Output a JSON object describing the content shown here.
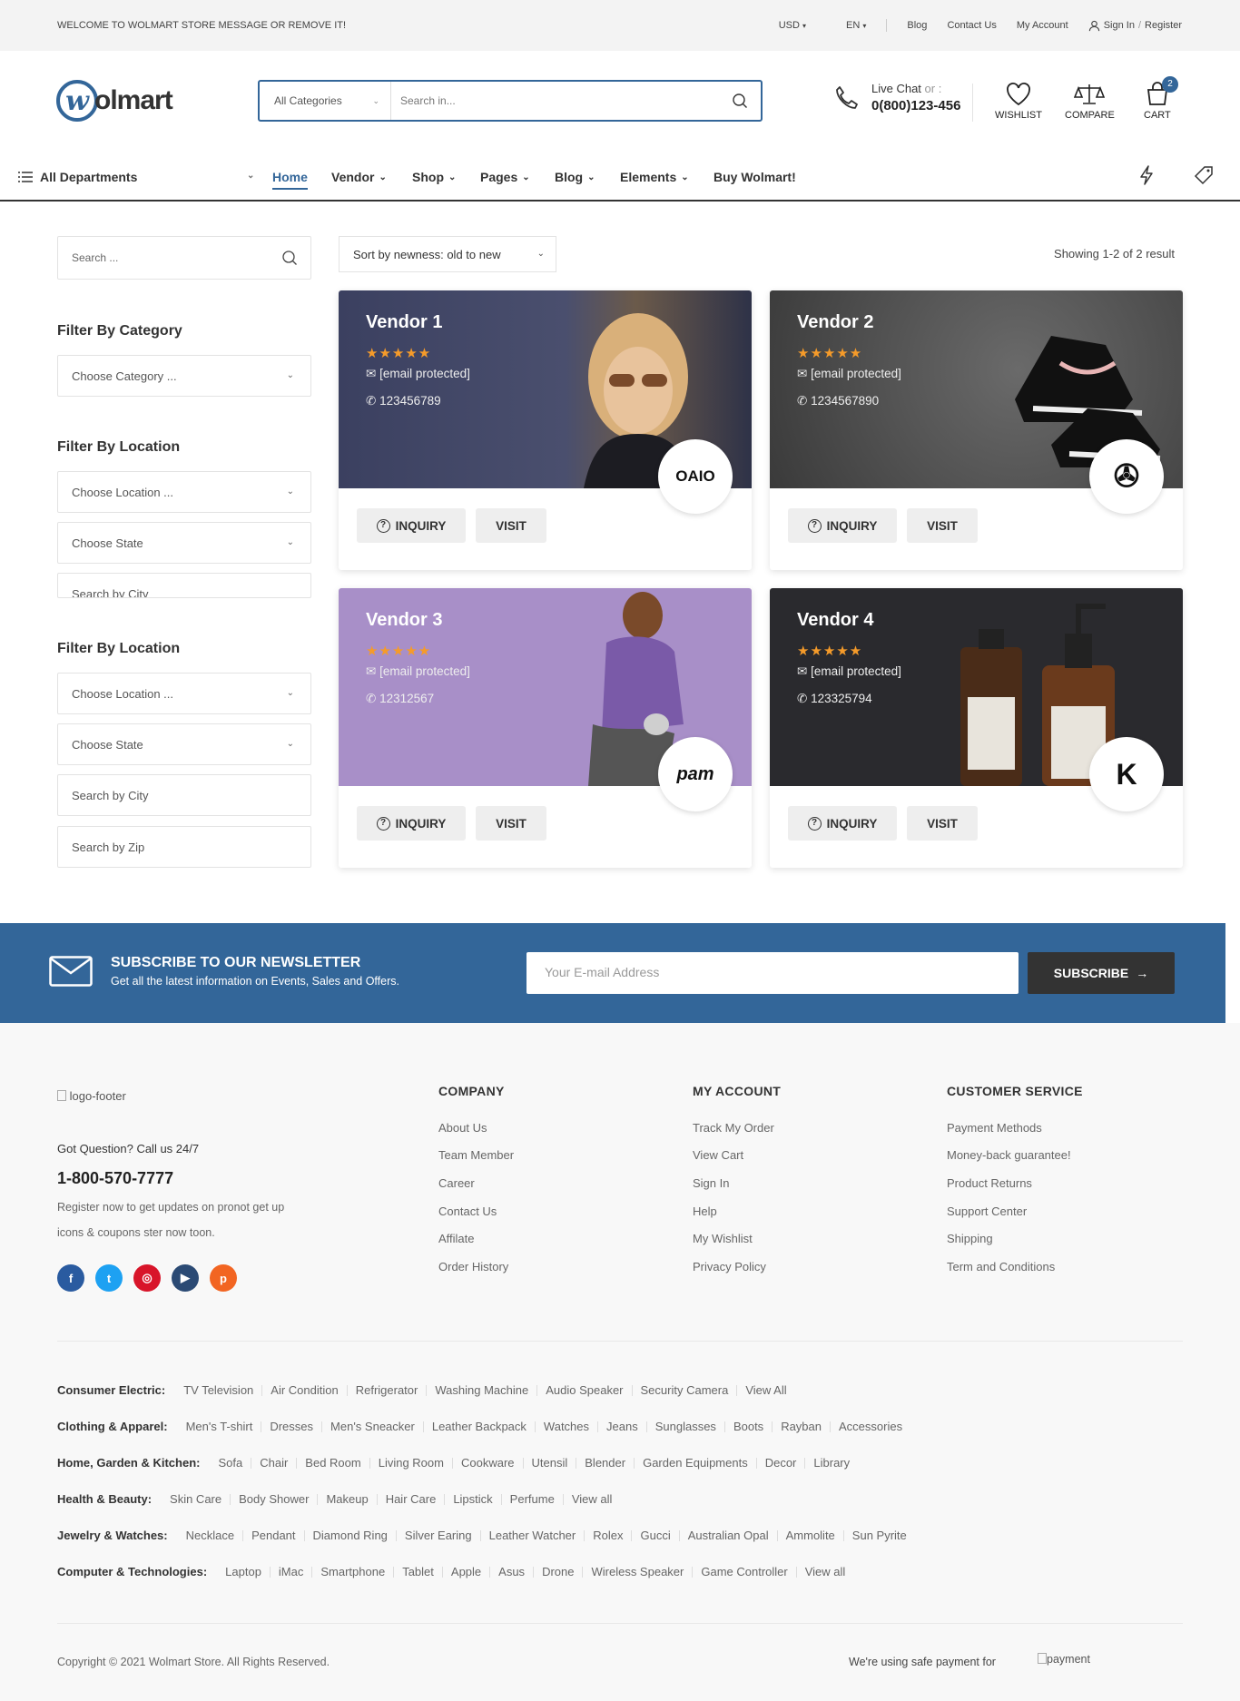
{
  "topbar": {
    "welcome": "WELCOME TO WOLMART STORE MESSAGE OR REMOVE IT!",
    "currency": "USD",
    "language": "EN",
    "links": [
      "Blog",
      "Contact Us",
      "My Account"
    ],
    "signin": "Sign In",
    "register": "Register"
  },
  "header": {
    "logo_letter": "w",
    "logo_text": "olmart",
    "search_category": "All Categories",
    "search_placeholder": "Search in...",
    "live_chat": "Live Chat",
    "live_or": "or :",
    "phone": "0(800)123-456",
    "wishlist": "WISHLIST",
    "compare": "COMPARE",
    "cart": "CART",
    "cart_count": "2"
  },
  "nav": {
    "departments": "All Departments",
    "items": [
      "Home",
      "Vendor",
      "Shop",
      "Pages",
      "Blog",
      "Elements",
      "Buy Wolmart!"
    ]
  },
  "sidebar": {
    "search_placeholder": "Search ...",
    "filter_category_title": "Filter By Category",
    "choose_category": "Choose Category ...",
    "filter_location_title": "Filter By Location",
    "choose_location": "Choose Location ...",
    "choose_state": "Choose State",
    "search_city": "Search by City",
    "filter_location_title2": "Filter By Location",
    "choose_location2": "Choose Location ...",
    "choose_state2": "Choose State",
    "search_city2": "Search by City",
    "search_zip": "Search by Zip"
  },
  "toolbar": {
    "sort": "Sort by newness: old to new",
    "showing": "Showing 1-2 of 2 result"
  },
  "vendors": [
    {
      "name": "Vendor 1",
      "stars": "★★★★★",
      "email": "[email protected]",
      "phone": "123456789",
      "logo": "OAIO",
      "bg": "#3a3f5c"
    },
    {
      "name": "Vendor 2",
      "stars": "★★★★★",
      "email": "[email protected]",
      "phone": "1234567890",
      "logo": "✇",
      "bg": "#4d4d4d"
    },
    {
      "name": "Vendor 3",
      "stars": "★★★★★",
      "email": "[email protected]",
      "phone": "12312567",
      "logo": "pam",
      "bg": "#a58dc6"
    },
    {
      "name": "Vendor 4",
      "stars": "★★★★★",
      "email": "[email protected]",
      "phone": "123325794",
      "logo": "K",
      "bg": "#2b2b2e"
    }
  ],
  "card_buttons": {
    "inquiry": "INQUIRY",
    "visit": "VISIT"
  },
  "newsletter": {
    "title": "SUBSCRIBE TO OUR NEWSLETTER",
    "subtitle": "Get all the latest information on Events, Sales and Offers.",
    "placeholder": "Your E-mail Address",
    "button": "SUBSCRIBE"
  },
  "footer": {
    "logo_alt": "logo-footer",
    "question": "Got Question? Call us 24/7",
    "phone": "1-800-570-7777",
    "text1": "Register now to get updates on pronot get up",
    "text2": "icons & coupons ster now toon.",
    "company_title": "Company",
    "company": [
      "About Us",
      "Team Member",
      "Career",
      "Contact Us",
      "Affilate",
      "Order History"
    ],
    "account_title": "My Account",
    "account": [
      "Track My Order",
      "View Cart",
      "Sign In",
      "Help",
      "My Wishlist",
      "Privacy Policy"
    ],
    "service_title": "Customer Service",
    "service": [
      "Payment Methods",
      "Money-back guarantee!",
      "Product Returns",
      "Support Center",
      "Shipping",
      "Term and Conditions"
    ],
    "copyright": "Copyright © 2021 Wolmart Store. All Rights Reserved.",
    "payment_text": "We're using safe payment for",
    "payment_alt": "payment"
  },
  "categories": [
    {
      "label": "Consumer Electric:",
      "links": [
        "TV Television",
        "Air Condition",
        "Refrigerator",
        "Washing Machine",
        "Audio Speaker",
        "Security Camera",
        "View All"
      ]
    },
    {
      "label": "Clothing & Apparel:",
      "links": [
        "Men's T-shirt",
        "Dresses",
        "Men's Sneacker",
        "Leather Backpack",
        "Watches",
        "Jeans",
        "Sunglasses",
        "Boots",
        "Rayban",
        "Accessories"
      ]
    },
    {
      "label": "Home, Garden & Kitchen:",
      "links": [
        "Sofa",
        "Chair",
        "Bed Room",
        "Living Room",
        "Cookware",
        "Utensil",
        "Blender",
        "Garden Equipments",
        "Decor",
        "Library"
      ]
    },
    {
      "label": "Health & Beauty:",
      "links": [
        "Skin Care",
        "Body Shower",
        "Makeup",
        "Hair Care",
        "Lipstick",
        "Perfume",
        "View all"
      ]
    },
    {
      "label": "Jewelry & Watches:",
      "links": [
        "Necklace",
        "Pendant",
        "Diamond Ring",
        "Silver Earing",
        "Leather Watcher",
        "Rolex",
        "Gucci",
        "Australian Opal",
        "Ammolite",
        "Sun Pyrite"
      ]
    },
    {
      "label": "Computer & Technologies:",
      "links": [
        "Laptop",
        "iMac",
        "Smartphone",
        "Tablet",
        "Apple",
        "Asus",
        "Drone",
        "Wireless Speaker",
        "Game Controller",
        "View all"
      ]
    }
  ]
}
